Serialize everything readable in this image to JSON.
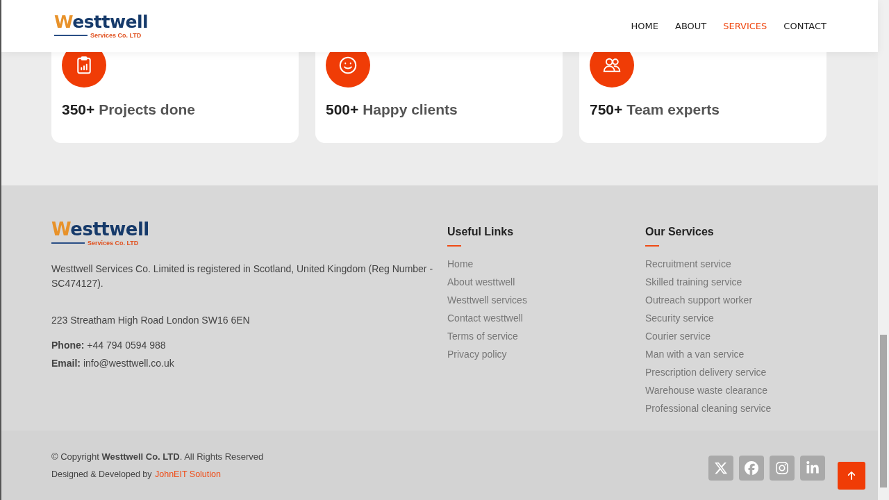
{
  "header": {
    "logo": {
      "name": "Westtwell",
      "tagline": "Services Co. LTD"
    },
    "nav": [
      {
        "label": "HOME",
        "selected": false
      },
      {
        "label": "ABOUT",
        "selected": false
      },
      {
        "label": "SERVICES",
        "selected": true
      },
      {
        "label": "CONTACT",
        "selected": false
      }
    ]
  },
  "stats": [
    {
      "number": "350+",
      "label": "Projects done"
    },
    {
      "number": "500+",
      "label": "Happy clients"
    },
    {
      "number": "750+",
      "label": "Team experts"
    }
  ],
  "footer": {
    "logo": {
      "name": "Westtwell",
      "tagline": "Services Co. LTD"
    },
    "about": "Westtwell Services Co. Limited is registered in Scotland, United Kingdom (Reg Number - SC474127).",
    "address": "223 Streatham High Road London SW16 6EN",
    "phone": "**Phone:** +44 794 0594 988",
    "email": "**Email:** info@westtwell.co.uk",
    "columns": [
      {
        "title": "Useful Links",
        "links": [
          "Home",
          "About westtwell",
          "Westtwell services",
          "Contact westtwell",
          "Terms of service",
          "Privacy policy"
        ]
      },
      {
        "title": "Our Services",
        "links": [
          "Recruitment service",
          "Skilled training service",
          "Outreach support worker",
          "Security service",
          "Courier service",
          "Man with a van service",
          "Prescription delivery service",
          "Warehouse waste clearance",
          "Professional cleaning service"
        ]
      }
    ]
  },
  "bottom": {
    "copyright": "© Copyright **Westtwell Co. LTD**. All Rights Reserved",
    "credit": "Designed & Developed by",
    "credit_link": "JohnEIT Solution"
  }
}
